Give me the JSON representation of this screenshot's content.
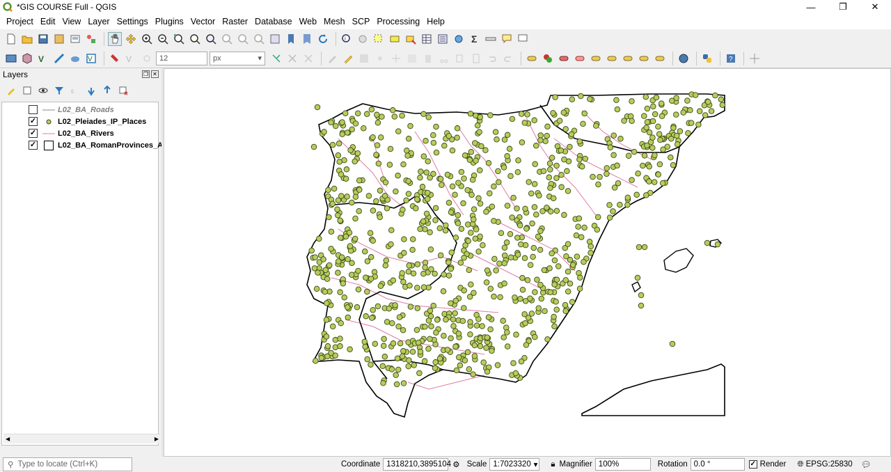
{
  "window": {
    "title": "*GIS COURSE Full - QGIS",
    "controls": [
      "—",
      "❐",
      "✕"
    ]
  },
  "menu": [
    "Project",
    "Edit",
    "View",
    "Layer",
    "Settings",
    "Plugins",
    "Vector",
    "Raster",
    "Database",
    "Web",
    "Mesh",
    "SCP",
    "Processing",
    "Help"
  ],
  "toolbar2": {
    "size_value": "12",
    "unit_value": "px"
  },
  "layers_panel": {
    "title": "Layers",
    "layers": [
      {
        "name": "L02_BA_Roads",
        "checked": false,
        "symbol": "line-gray",
        "style": "dim"
      },
      {
        "name": "L02_Pleiades_IP_Places",
        "checked": true,
        "symbol": "point",
        "style": "bold"
      },
      {
        "name": "L02_BA_Rivers",
        "checked": true,
        "symbol": "line-pink",
        "style": "bold"
      },
      {
        "name": "L02_BA_RomanProvinces_A",
        "checked": true,
        "symbol": "polygon",
        "style": "bold"
      }
    ]
  },
  "statusbar": {
    "locate_placeholder": "Type to locate (Ctrl+K)",
    "coordinate_label": "Coordinate",
    "coordinate_value": "1318210,3895104",
    "scale_label": "Scale",
    "scale_value": "1:7023320",
    "magnifier_label": "Magnifier",
    "magnifier_value": "100%",
    "rotation_label": "Rotation",
    "rotation_value": "0.0 °",
    "render_label": "Render",
    "crs_label": "EPSG:25830"
  },
  "colors": {
    "point_fill": "#b8cc5c",
    "point_stroke": "#3a4a18",
    "river": "#e07aa8",
    "boundary": "#000000"
  }
}
